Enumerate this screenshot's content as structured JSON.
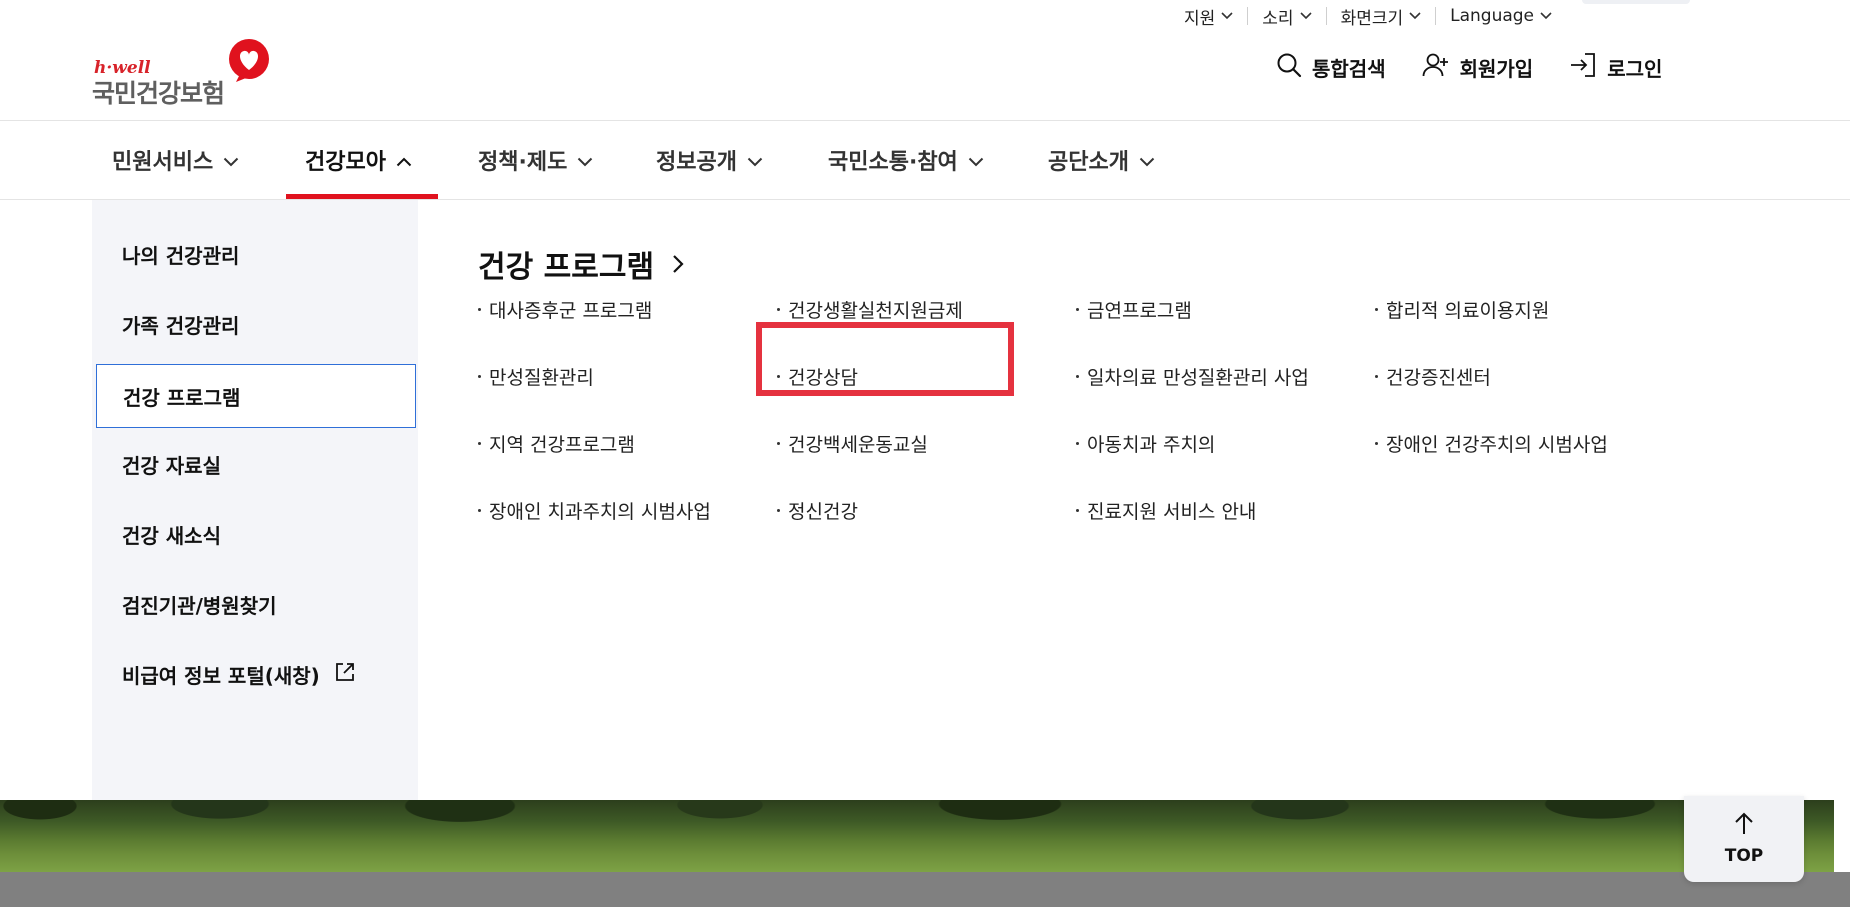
{
  "utility": {
    "items": [
      {
        "label": "지원"
      },
      {
        "label": "소리"
      },
      {
        "label": "화면크기"
      },
      {
        "label": "Language"
      }
    ]
  },
  "logo": {
    "tagline": "h·well",
    "name": "국민건강보험"
  },
  "header_actions": {
    "search": "통합검색",
    "signup": "회원가입",
    "login": "로그인"
  },
  "gnb": {
    "items": [
      {
        "label": "민원서비스",
        "active": false
      },
      {
        "label": "건강모아",
        "active": true
      },
      {
        "label": "정책·제도",
        "active": false
      },
      {
        "label": "정보공개",
        "active": false
      },
      {
        "label": "국민소통·참여",
        "active": false
      },
      {
        "label": "공단소개",
        "active": false
      }
    ]
  },
  "side_menu": {
    "items": [
      {
        "label": "나의 건강관리",
        "active": false
      },
      {
        "label": "가족 건강관리",
        "active": false
      },
      {
        "label": "건강 프로그램",
        "active": true
      },
      {
        "label": "건강 자료실",
        "active": false
      },
      {
        "label": "건강 새소식",
        "active": false
      },
      {
        "label": "검진기관/병원찾기",
        "active": false
      },
      {
        "label": "비급여 정보 포털(새창)",
        "active": false,
        "external": true
      }
    ]
  },
  "content": {
    "title": "건강 프로그램",
    "links": [
      [
        "대사증후군 프로그램",
        "건강생활실천지원금제",
        "금연프로그램",
        "합리적 의료이용지원"
      ],
      [
        "만성질환관리",
        "건강상담",
        "일차의료 만성질환관리 사업",
        "건강증진센터"
      ],
      [
        "지역 건강프로그램",
        "건강백세운동교실",
        "아동치과 주치의",
        "장애인 건강주치의 시범사업"
      ],
      [
        "장애인 치과주치의 시범사업",
        "정신건강",
        "진료지원 서비스 안내"
      ]
    ],
    "highlighted": "건강생활실천지원금제"
  },
  "top_button": {
    "label": "TOP"
  },
  "colors": {
    "brand_red": "#e0121e",
    "highlight_red": "#e5323f",
    "active_border": "#2f6fd8",
    "side_bg": "#f4f5f9"
  }
}
